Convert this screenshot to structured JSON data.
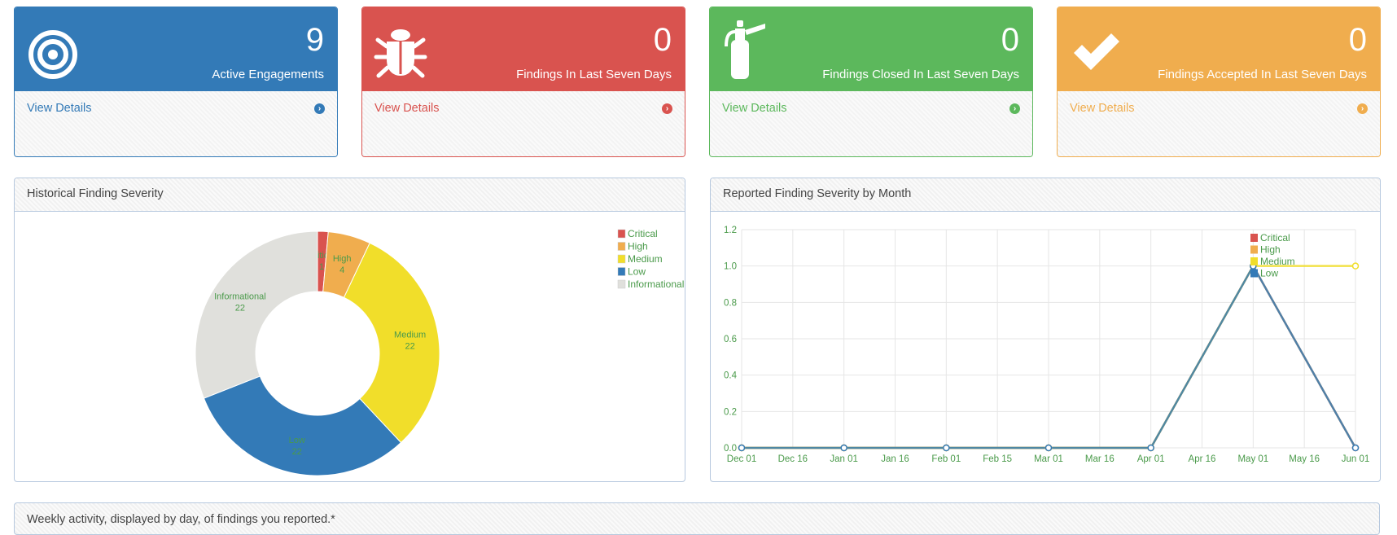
{
  "cards": [
    {
      "count": "9",
      "label": "Active Engagements",
      "link": "View Details",
      "icon": "target-icon",
      "color": "#337ab7"
    },
    {
      "count": "0",
      "label": "Findings In Last Seven Days",
      "link": "View Details",
      "icon": "bug-icon",
      "color": "#d9534f"
    },
    {
      "count": "0",
      "label": "Findings Closed In Last Seven Days",
      "link": "View Details",
      "icon": "fire-extinguisher-icon",
      "color": "#5cb85c"
    },
    {
      "count": "0",
      "label": "Findings Accepted In Last Seven Days",
      "link": "View Details",
      "icon": "check-icon",
      "color": "#f0ad4e"
    }
  ],
  "panels": {
    "historical_title": "Historical Finding Severity",
    "monthly_title": "Reported Finding Severity by Month",
    "weekly_title": "Weekly activity, displayed by day, of findings you reported.*"
  },
  "chart_data": [
    {
      "type": "pie",
      "title": "Historical Finding Severity",
      "categories": [
        "Critical",
        "High",
        "Medium",
        "Low",
        "Informational"
      ],
      "values": [
        1,
        4,
        22,
        22,
        22
      ],
      "colors": [
        "#d9534f",
        "#f0ad4e",
        "#f1de2a",
        "#337ab7",
        "#e0e0dc"
      ],
      "legend": "top-right"
    },
    {
      "type": "line",
      "title": "Reported Finding Severity by Month",
      "x": [
        "Dec 01",
        "Jan 01",
        "Feb 01",
        "Mar 01",
        "Apr 01",
        "May 01",
        "Jun 01"
      ],
      "x_ticks": [
        "Dec 01",
        "Dec 16",
        "Jan 01",
        "Jan 16",
        "Feb 01",
        "Feb 15",
        "Mar 01",
        "Mar 16",
        "Apr 01",
        "Apr 16",
        "May 01",
        "May 16",
        "Jun 01"
      ],
      "y_ticks": [
        "0.0",
        "0.2",
        "0.4",
        "0.6",
        "0.8",
        "1.0",
        "1.2"
      ],
      "ylim": [
        0,
        1.2
      ],
      "series": [
        {
          "name": "Critical",
          "values": [
            0,
            0,
            0,
            0,
            0,
            1,
            0
          ],
          "color": "#d9534f"
        },
        {
          "name": "High",
          "values": [
            0,
            0,
            0,
            0,
            0,
            1,
            0
          ],
          "color": "#f0ad4e"
        },
        {
          "name": "Medium",
          "values": [
            0,
            0,
            0,
            0,
            0,
            1,
            1
          ],
          "color": "#f1de2a"
        },
        {
          "name": "Low",
          "values": [
            0,
            0,
            0,
            0,
            0,
            1,
            0
          ],
          "color": "#337ab7"
        }
      ],
      "grid": true,
      "legend": "top-right"
    }
  ]
}
